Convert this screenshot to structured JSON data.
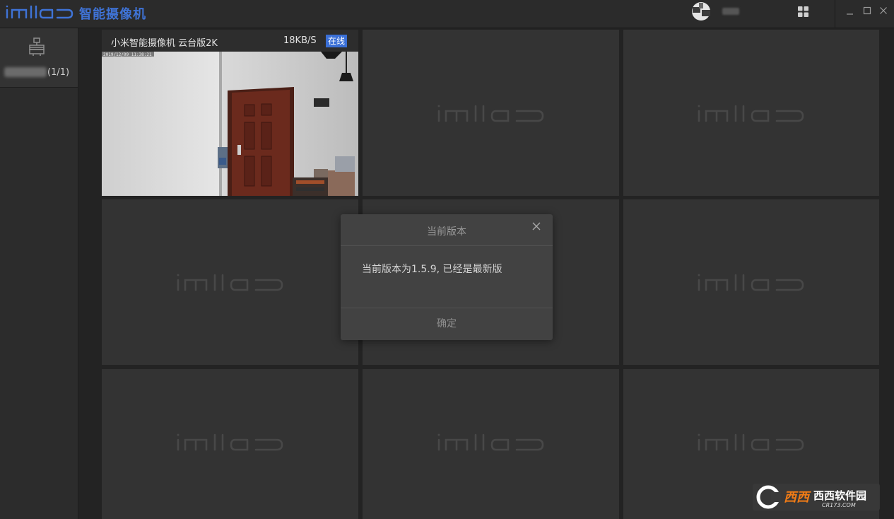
{
  "window": {
    "logo_text": "imilab",
    "title": "智能摄像机"
  },
  "sidebar": {
    "group_count": "(1/1)"
  },
  "grid": {
    "watermark": "imilab",
    "live_cell": {
      "camera_name": "小米智能摄像机 云台版2K",
      "data_rate": "18KB/S",
      "status": "在线",
      "timestamp": "2019/12/09 11:38:21"
    }
  },
  "dialog": {
    "title": "当前版本",
    "message": "当前版本为1.5.9, 已经是最新版",
    "confirm_label": "确定"
  },
  "corner_badge": {
    "text": "西西软件园",
    "url": "CR173.COM"
  },
  "colors": {
    "brand_blue": "#3f73d6",
    "status_badge": "#3a6fd6",
    "background": "#232323",
    "cell": "#333333"
  }
}
